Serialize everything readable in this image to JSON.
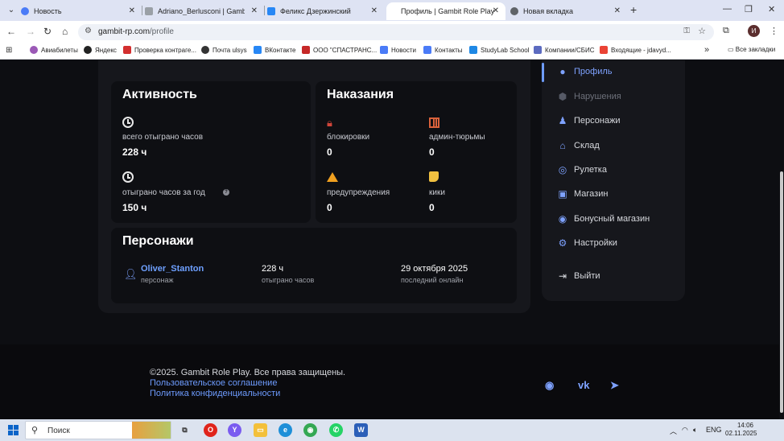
{
  "browser": {
    "tabs": [
      {
        "title": "Новость",
        "favicon_color": "#4a7bf7"
      },
      {
        "title": "Adriano_Berlusconi | Gambit Role",
        "favicon_color": "#9aa0a6"
      },
      {
        "title": "Феликс Дзержинский",
        "favicon_color": "#2787f5"
      },
      {
        "title": "Профиль | Gambit Role Play",
        "favicon_color": "#ffffff"
      },
      {
        "title": "Новая вкладка",
        "favicon_color": "#5f6368"
      }
    ],
    "new_tab": "+",
    "url_host": "gambit-rp.com",
    "url_path": "/profile",
    "avatar_letter": "И",
    "bookmarks": [
      {
        "label": "Авиабилеты",
        "color": "#9b59b6"
      },
      {
        "label": "Яндекс",
        "color": "#222222"
      },
      {
        "label": "Проверка контраге...",
        "color": "#d32f2f"
      },
      {
        "label": "Почта ulsys",
        "color": "#333333"
      },
      {
        "label": "ВКонтакте",
        "color": "#2787f5"
      },
      {
        "label": "ООО \"СПАСТРАНС...",
        "color": "#c62828"
      },
      {
        "label": "Новости",
        "color": "#4a7bf7"
      },
      {
        "label": "Контакты",
        "color": "#4a7bf7"
      },
      {
        "label": "StudyLab School",
        "color": "#1e88e5"
      },
      {
        "label": "Компании/СБИС",
        "color": "#5c6bc0"
      },
      {
        "label": "Входящие - jdavyd...",
        "color": "#ea4335"
      }
    ],
    "bookmarks_more": "»",
    "all_bookmarks": "Все закладки"
  },
  "activity": {
    "title": "Активность",
    "total_label": "всего отыграно часов",
    "total_value": "228 ч",
    "year_label": "отыграно часов за год",
    "year_value": "150 ч"
  },
  "punishments": {
    "title": "Наказания",
    "items": [
      {
        "label": "блокировки",
        "value": "0",
        "icon": "lock-icon"
      },
      {
        "label": "админ-тюрьмы",
        "value": "0",
        "icon": "jail-icon"
      },
      {
        "label": "предупреждения",
        "value": "0",
        "icon": "warning-icon"
      },
      {
        "label": "кики",
        "value": "0",
        "icon": "boot-icon"
      }
    ]
  },
  "characters": {
    "title": "Персонажи",
    "rows": [
      {
        "name": "Oliver_Stanton",
        "name_sub": "персонаж",
        "hours": "228 ч",
        "hours_sub": "отыграно часов",
        "last_online": "29 октября 2025",
        "last_online_sub": "последний онлайн"
      }
    ]
  },
  "sidebar": {
    "items": [
      {
        "label": "Профиль",
        "icon": "user-circle-icon",
        "state": "active"
      },
      {
        "label": "Нарушения",
        "icon": "shield-icon",
        "state": "disabled"
      },
      {
        "label": "Персонажи",
        "icon": "person-icon",
        "state": "normal"
      },
      {
        "label": "Склад",
        "icon": "warehouse-icon",
        "state": "normal"
      },
      {
        "label": "Рулетка",
        "icon": "roulette-icon",
        "state": "normal"
      },
      {
        "label": "Магазин",
        "icon": "store-icon",
        "state": "normal"
      },
      {
        "label": "Бонусный магазин",
        "icon": "bonus-icon",
        "state": "normal"
      },
      {
        "label": "Настройки",
        "icon": "gear-icon",
        "state": "normal"
      },
      {
        "label": "Выйти",
        "icon": "logout-icon",
        "state": "normal"
      }
    ]
  },
  "footer": {
    "copyright": "©2025. Gambit Role Play. Все права защищены.",
    "terms": "Пользовательское соглашение",
    "privacy": "Политика конфиденциальности",
    "socials": [
      "discord-icon",
      "vk-icon",
      "telegram-icon"
    ]
  },
  "taskbar": {
    "search_placeholder": "Поиск",
    "lang": "ENG",
    "time": "14:06",
    "date": "02.11.2025"
  },
  "colors": {
    "accent": "#6e9cff",
    "bg": "#0d0e12",
    "card": "#16171c"
  }
}
